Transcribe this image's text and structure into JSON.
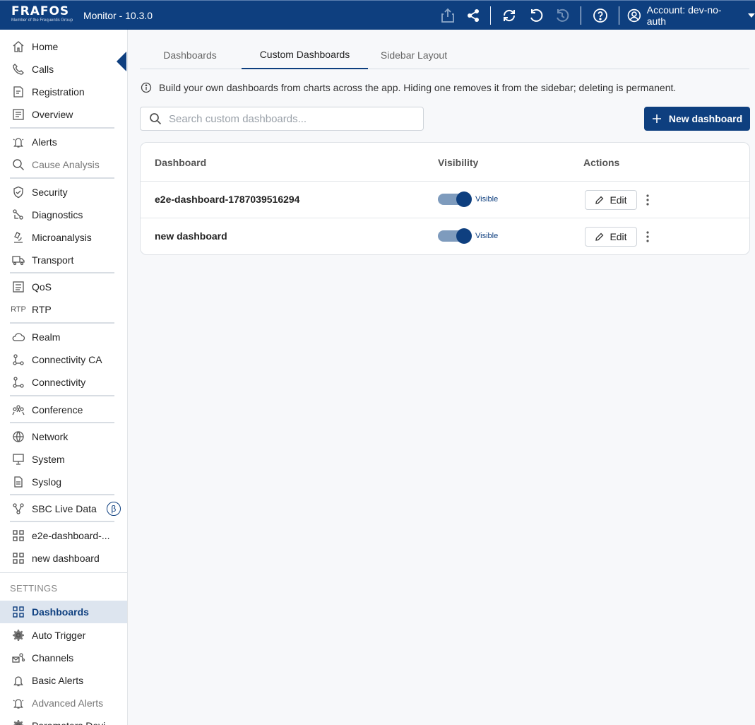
{
  "app": {
    "logo": "FRAFOS",
    "logo_tagline": "Member of the Frequentis Group",
    "title": "Monitor - 10.3.0"
  },
  "topbar": {
    "icons": [
      "export-icon",
      "share-icon",
      "refresh-icon",
      "undo-icon",
      "history-icon",
      "help-icon"
    ],
    "account_label": "Account: dev-no-auth"
  },
  "sidebar": {
    "items": [
      {
        "label": "Home",
        "icon": "home-icon"
      },
      {
        "label": "Calls",
        "icon": "phone-icon"
      },
      {
        "label": "Registration",
        "icon": "registration-icon"
      },
      {
        "label": "Overview",
        "icon": "overview-icon"
      },
      {
        "label": "Alerts",
        "icon": "alert-bell-icon"
      },
      {
        "label": "Cause Analysis",
        "icon": "search-icon"
      },
      {
        "label": "Security",
        "icon": "shield-icon"
      },
      {
        "label": "Diagnostics",
        "icon": "diagnostics-icon"
      },
      {
        "label": "Microanalysis",
        "icon": "microscope-icon"
      },
      {
        "label": "Transport",
        "icon": "truck-icon"
      },
      {
        "label": "QoS",
        "icon": "qos-icon"
      },
      {
        "label": "RTP",
        "icon": "rtp-icon",
        "icon_text": "RTP"
      },
      {
        "label": "Realm",
        "icon": "cloud-icon"
      },
      {
        "label": "Connectivity CA",
        "icon": "connectivity-icon"
      },
      {
        "label": "Connectivity",
        "icon": "connectivity-icon"
      },
      {
        "label": "Conference",
        "icon": "people-icon"
      },
      {
        "label": "Network",
        "icon": "globe-icon"
      },
      {
        "label": "System",
        "icon": "monitor-icon"
      },
      {
        "label": "Syslog",
        "icon": "document-icon"
      },
      {
        "label": "SBC Live Data",
        "icon": "graph-icon",
        "badge": "β"
      },
      {
        "label": "e2e-dashboard-...",
        "icon": "dashboard-icon"
      },
      {
        "label": "new dashboard",
        "icon": "dashboard-icon"
      }
    ],
    "settings_heading": "SETTINGS",
    "settings_items": [
      {
        "label": "Dashboards",
        "icon": "dashboard-icon",
        "active": true
      },
      {
        "label": "Auto Trigger",
        "icon": "gear-icon"
      },
      {
        "label": "Channels",
        "icon": "channels-icon"
      },
      {
        "label": "Basic Alerts",
        "icon": "bell-icon"
      },
      {
        "label": "Advanced Alerts",
        "icon": "alert-bell-icon"
      },
      {
        "label": "Parameters Devi",
        "icon": "gear-icon"
      }
    ]
  },
  "tabs": [
    {
      "label": "Dashboards"
    },
    {
      "label": "Custom Dashboards",
      "active": true
    },
    {
      "label": "Sidebar Layout"
    }
  ],
  "info_text": "Build your own dashboards from charts across the app. Hiding one removes it from the sidebar; deleting is permanent.",
  "search": {
    "placeholder": "Search custom dashboards...",
    "value": ""
  },
  "new_button_label": "New dashboard",
  "table": {
    "headers": {
      "name": "Dashboard",
      "visibility": "Visibility",
      "actions": "Actions"
    },
    "rows": [
      {
        "name": "e2e-dashboard-1787039516294",
        "visible": true,
        "visibility_label": "Visible",
        "edit_label": "Edit"
      },
      {
        "name": "new dashboard",
        "visible": true,
        "visibility_label": "Visible",
        "edit_label": "Edit"
      }
    ]
  },
  "colors": {
    "brand": "#0e3f7f",
    "toggle_track": "#7e9bbd",
    "active_bg": "#dde5ef"
  }
}
